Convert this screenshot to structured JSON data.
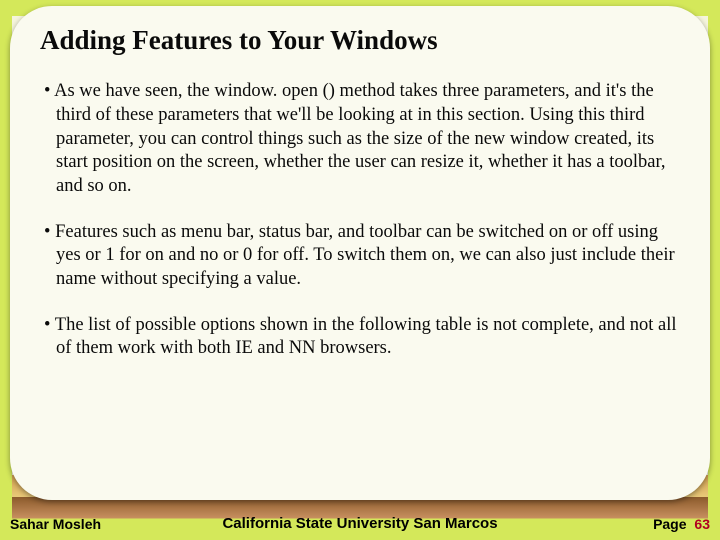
{
  "slide": {
    "title": "Adding Features to Your Windows",
    "bullets": [
      "As we have seen, the window. open () method takes three parameters, and it's the third of these parameters that we'll be looking at in this section. Using this third parameter, you can control things such as the size of the new window created, its start position on the screen, whether the user can resize it, whether it has a toolbar, and so on.",
      "Features such as menu bar, status bar, and toolbar can be switched on or off using yes or 1 for on and no or 0 for off. To switch them on, we can also just include their name without specifying a value.",
      "The list of possible options shown in the following table is not complete, and not all of them work with both IE and NN browsers."
    ]
  },
  "footer": {
    "author": "Sahar Mosleh",
    "university": "California State University San Marcos",
    "page_label": "Page",
    "page_number": "63"
  }
}
